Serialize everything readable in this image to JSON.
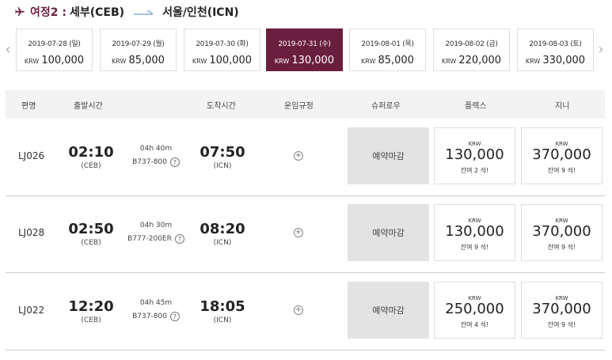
{
  "header": {
    "leg_label": "여정2 :",
    "origin": "세부(CEB)",
    "destination": "서울/인천(ICN)",
    "accent_color": "#6b1f3f"
  },
  "date_strip": {
    "selected_index": 3,
    "dates": [
      {
        "date": "2019-07-28 (일)",
        "currency": "KRW",
        "price": "100,000"
      },
      {
        "date": "2019-07-29 (월)",
        "currency": "KRW",
        "price": "85,000"
      },
      {
        "date": "2019-07-30 (화)",
        "currency": "KRW",
        "price": "100,000"
      },
      {
        "date": "2019-07-31 (수)",
        "currency": "KRW",
        "price": "130,000"
      },
      {
        "date": "2019-08-01 (목)",
        "currency": "KRW",
        "price": "85,000"
      },
      {
        "date": "2019-08-02 (금)",
        "currency": "KRW",
        "price": "220,000"
      },
      {
        "date": "2019-08-03 (토)",
        "currency": "KRW",
        "price": "330,000"
      }
    ]
  },
  "table": {
    "headers": {
      "flight": "편명",
      "departure": "출발시간",
      "arrival": "도착시간",
      "fare_rules": "운임규정",
      "super_low": "슈퍼로우",
      "flex": "플렉스",
      "jini": "지니"
    },
    "rows": [
      {
        "flight_no": "LJ026",
        "dep_time": "02:10",
        "dep_airport": "(CEB)",
        "duration": "04h 40m",
        "aircraft": "B737-800",
        "arr_time": "07:50",
        "arr_airport": "(ICN)",
        "super_low": "예약마감",
        "flex": {
          "currency": "KRW",
          "amount": "130,000",
          "seats": "잔여 2 석!"
        },
        "jini": {
          "currency": "KRW",
          "amount": "370,000",
          "seats": "잔여 9 석!"
        }
      },
      {
        "flight_no": "LJ028",
        "dep_time": "02:50",
        "dep_airport": "(CEB)",
        "duration": "04h 30m",
        "aircraft": "B777-200ER",
        "arr_time": "08:20",
        "arr_airport": "(ICN)",
        "super_low": "예약마감",
        "flex": {
          "currency": "KRW",
          "amount": "130,000",
          "seats": "잔여 9 석!"
        },
        "jini": {
          "currency": "KRW",
          "amount": "370,000",
          "seats": "잔여 9 석!"
        }
      },
      {
        "flight_no": "LJ022",
        "dep_time": "12:20",
        "dep_airport": "(CEB)",
        "duration": "04h 45m",
        "aircraft": "B737-800",
        "arr_time": "18:05",
        "arr_airport": "(ICN)",
        "super_low": "예약마감",
        "flex": {
          "currency": "KRW",
          "amount": "250,000",
          "seats": "잔여 4 석!"
        },
        "jini": {
          "currency": "KRW",
          "amount": "370,000",
          "seats": "잔여 9 석!"
        }
      }
    ]
  }
}
